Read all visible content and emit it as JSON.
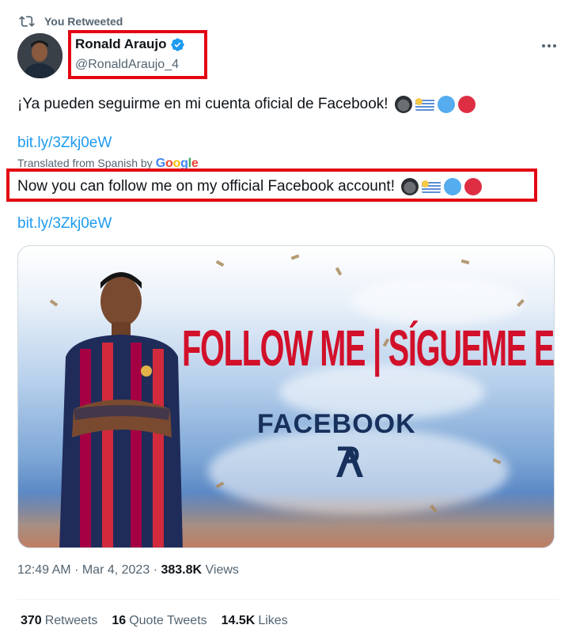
{
  "retweet": {
    "label": "You Retweeted",
    "icon": "retweet-icon"
  },
  "author": {
    "display_name": "Ronald Araujo",
    "handle": "@RonaldAraujo_4",
    "verified_icon": "verified-badge-icon",
    "verified_color": "#1d9bf0",
    "avatar_icon": "avatar"
  },
  "more": {
    "icon": "more-options-icon"
  },
  "tweet": {
    "text": "¡Ya pueden seguirme en mi cuenta oficial de Facebook!",
    "emojis": [
      "gorilla-emoji",
      "uruguay-flag-emoji",
      "blue-circle-emoji",
      "red-circle-emoji"
    ],
    "link1": "bit.ly/3Zkj0eW",
    "link2": "bit.ly/3Zkj0eW"
  },
  "translation": {
    "label": "Translated from Spanish by",
    "brand": "Google",
    "text": "Now you can follow me on my official Facebook account!"
  },
  "media": {
    "headline": "FOLLOW ME | SÍGUEME EN",
    "platform": "FACEBOOK",
    "logo_text": "RA"
  },
  "meta": {
    "time": "12:49 AM",
    "separator": "·",
    "date": "Mar 4, 2023",
    "views_count": "383.8K",
    "views_label": "Views"
  },
  "stats": {
    "retweets_count": "370",
    "retweets_label": "Retweets",
    "quote_count": "16",
    "quote_label": "Quote Tweets",
    "likes_count": "14.5K",
    "likes_label": "Likes"
  },
  "colors": {
    "accent": "#1d9bf0",
    "highlight_box": "#e30613",
    "headline_red": "#d2102a",
    "text_secondary": "#536471"
  }
}
